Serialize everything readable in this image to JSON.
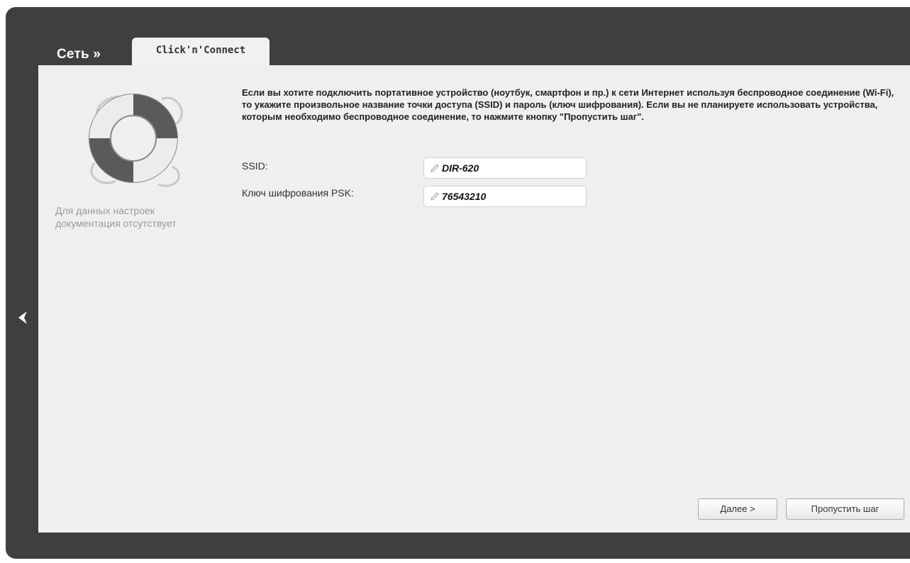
{
  "header": {
    "section_title": "Сеть »",
    "tab_label": "Click'n'Connect"
  },
  "sidebar": {
    "doc_note": "Для данных настроек документация отсутствует"
  },
  "main": {
    "intro_text": "Если вы хотите подключить портативное устройство (ноутбук, смартфон и пр.) к сети Интернет используя беспроводное соединение (Wi-Fi), то укажите произвольное название точки доступа (SSID) и пароль (ключ шифрования). Если вы не планируете использовать устройства, которым необходимо беспроводное соединение, то нажмите кнопку \"Пропустить шаг\".",
    "ssid": {
      "label": "SSID:",
      "value": "DIR-620"
    },
    "psk": {
      "label": "Ключ шифрования PSK:",
      "value": "76543210"
    }
  },
  "buttons": {
    "next_label": "Далее >",
    "skip_label": "Пропустить шаг"
  },
  "icons": {
    "back": "chevron-left-icon",
    "help": "lifebuoy-icon",
    "edit": "pencil-icon"
  },
  "colors": {
    "frame": "#3f3f3f",
    "panel": "#efefef"
  }
}
